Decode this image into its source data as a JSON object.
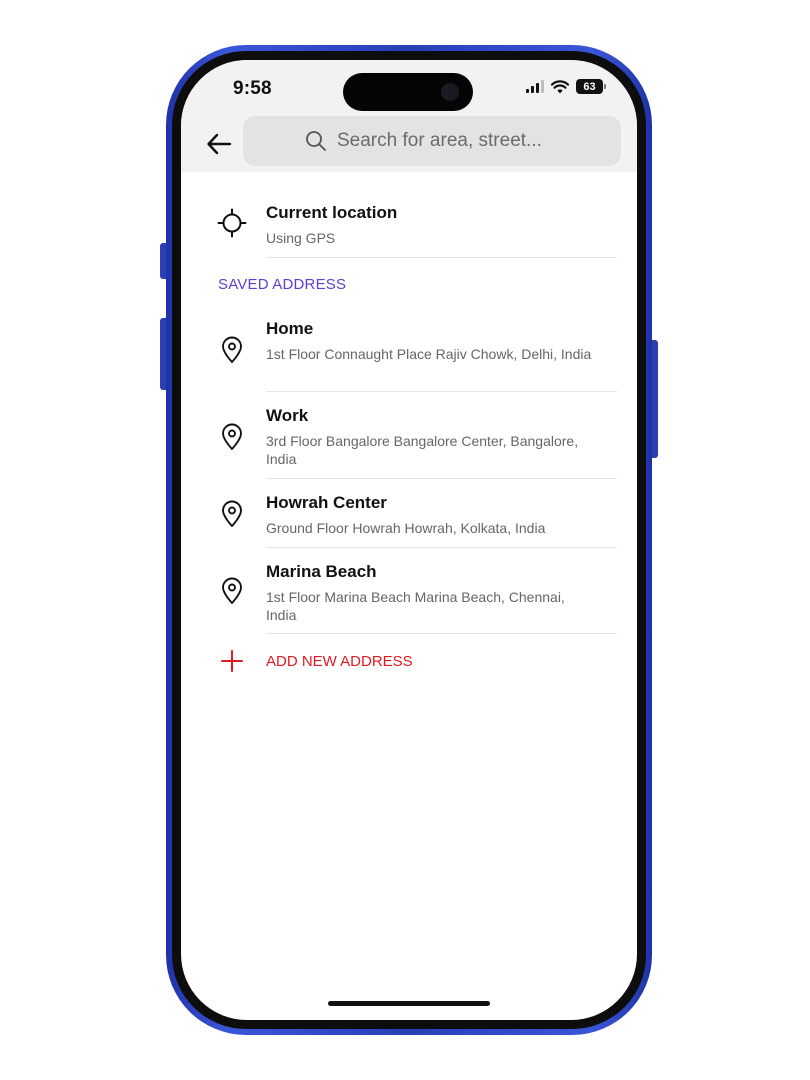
{
  "status_bar": {
    "time": "9:58",
    "battery": "63"
  },
  "search": {
    "placeholder": "Search for area, street..."
  },
  "current_location": {
    "title": "Current location",
    "subtitle": "Using GPS"
  },
  "saved_section_label": "SAVED ADDRESS",
  "addresses": [
    {
      "title": "Home",
      "subtitle": "1st Floor Connaught Place Rajiv Chowk, Delhi, India"
    },
    {
      "title": "Work",
      "subtitle": "3rd Floor Bangalore Bangalore Center, Bangalore, India"
    },
    {
      "title": "Howrah Center",
      "subtitle": "Ground Floor Howrah Howrah, Kolkata, India"
    },
    {
      "title": "Marina Beach",
      "subtitle": "1st Floor Marina Beach Marina Beach, Chennai, India"
    }
  ],
  "add_address_label": "ADD NEW ADDRESS",
  "icons": {
    "back": "arrow-left-icon",
    "search": "search-icon",
    "gps": "crosshair-icon",
    "pin": "location-pin-icon",
    "plus": "plus-icon"
  },
  "colors": {
    "accent": "#5b3fd6",
    "add": "#e01a22",
    "frame": "#2b3fb3"
  }
}
